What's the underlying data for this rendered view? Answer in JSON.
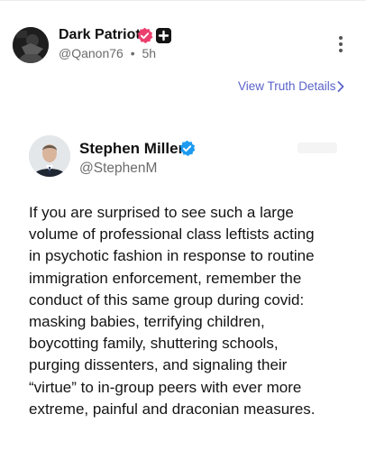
{
  "post": {
    "author_name": "Dark Patriot",
    "author_handle": "@Qanon76",
    "separator": "•",
    "age": "5h",
    "view_details_label": "View Truth Details",
    "colors": {
      "verified_badge": "#ec3f6e",
      "link": "#5a63c9",
      "handle": "#6b6b6b"
    }
  },
  "embed": {
    "author_name": "Stephen Miller",
    "author_handle": "@StephenM",
    "verified_color": "#1d9bf0",
    "text_lines": [
      "If you are surprised to see such a large",
      "volume of professional class leftists acting",
      "in psychotic fashion in response to routine",
      "immigration enforcement, remember the",
      "conduct of this same group during covid:",
      "masking babies, terrifying children,",
      "boycotting family, shuttering schools,",
      "purging dissenters, and signaling their",
      "“virtue” to in-group peers with ever more",
      "extreme, painful and draconian measures."
    ]
  },
  "icons": {
    "author_verified": "verified-badge-icon",
    "author_plus": "plus-badge-icon",
    "more": "more-vertical-icon",
    "chevron": "chevron-right-icon",
    "embed_verified": "verified-check-icon"
  }
}
